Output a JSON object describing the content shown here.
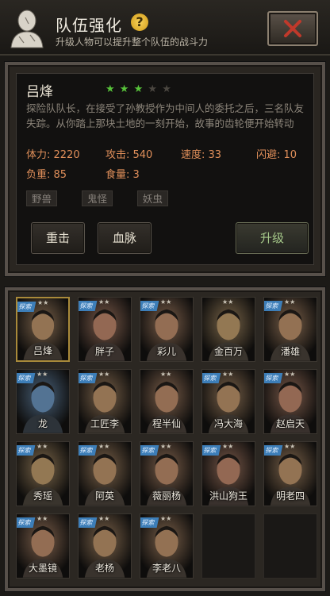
{
  "header": {
    "title": "队伍强化",
    "help_glyph": "?",
    "subtitle": "升级人物可以提升整个队伍的战斗力"
  },
  "hero": {
    "name": "吕烽",
    "stars_filled": 3,
    "stars_total": 5,
    "description": "探险队队长，在接受了孙教授作为中间人的委托之后，三名队友失踪。从你踏上那块土地的一刻开始，故事的齿轮便开始转动",
    "stats": {
      "hp": "体力: 2220",
      "attack": "攻击: 540",
      "speed": "速度: 33",
      "dodge": "闪避: 10",
      "load": "负重: 85",
      "food": "食量: 3"
    },
    "tags": [
      "野兽",
      "鬼怪",
      "妖虫"
    ]
  },
  "actions": {
    "reroll": "重击",
    "bloodline": "血脉",
    "upgrade": "升级"
  },
  "roster": {
    "badge": "探索",
    "cards": [
      {
        "name": "吕烽",
        "stars": "★★",
        "badge": true,
        "selected": true
      },
      {
        "name": "胖子",
        "stars": "★★",
        "badge": true
      },
      {
        "name": "彩儿",
        "stars": "★★",
        "badge": true
      },
      {
        "name": "金百万",
        "stars": "★★",
        "badge": false
      },
      {
        "name": "潘雄",
        "stars": "★★",
        "badge": true
      },
      {
        "name": "龙",
        "stars": "★★",
        "badge": true
      },
      {
        "name": "工匠李",
        "stars": "★★",
        "badge": true
      },
      {
        "name": "程半仙",
        "stars": "★★",
        "badge": false
      },
      {
        "name": "冯大海",
        "stars": "★★",
        "badge": true
      },
      {
        "name": "赵启天",
        "stars": "★★",
        "badge": true
      },
      {
        "name": "秀瑶",
        "stars": "★★",
        "badge": true
      },
      {
        "name": "阿英",
        "stars": "★★",
        "badge": true
      },
      {
        "name": "薇丽杨",
        "stars": "★★",
        "badge": true
      },
      {
        "name": "洪山狗王",
        "stars": "★★",
        "badge": true
      },
      {
        "name": "明老四",
        "stars": "★★",
        "badge": true
      },
      {
        "name": "大墨镜",
        "stars": "★★",
        "badge": true
      },
      {
        "name": "老杨",
        "stars": "★★",
        "badge": true
      },
      {
        "name": "李老八",
        "stars": "★★",
        "badge": true
      },
      {
        "name": "",
        "empty": true
      },
      {
        "name": "",
        "empty": true
      }
    ]
  },
  "colors": {
    "stat_text": "#e08f5a",
    "star_active": "#57c23a",
    "badge": "#3d7eb8",
    "selected_border": "#a98a3a"
  }
}
